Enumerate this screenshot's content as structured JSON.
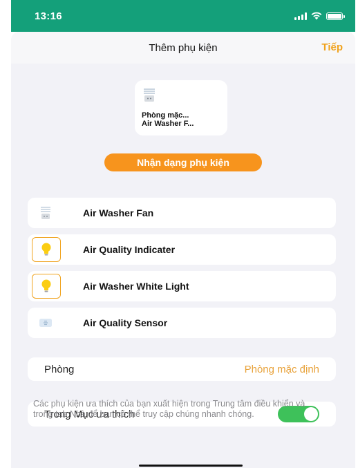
{
  "status_bar": {
    "time": "13:16"
  },
  "navbar": {
    "title": "Thêm phụ kiện",
    "next_label": "Tiếp"
  },
  "accessory_tile": {
    "name_line1": "Phòng mặc...",
    "name_line2": "Air Washer F..."
  },
  "identify_button": {
    "label": "Nhận dạng phụ kiện"
  },
  "accessories": [
    {
      "label": "Air Washer Fan",
      "icon": "air-washer-fan-icon"
    },
    {
      "label": "Air Quality Indicater",
      "icon": "lightbulb-icon"
    },
    {
      "label": "Air Washer White Light",
      "icon": "lightbulb-icon"
    },
    {
      "label": "Air Quality Sensor",
      "icon": "sensor-icon"
    }
  ],
  "room": {
    "label": "Phòng",
    "value": "Phòng mặc định"
  },
  "favorites": {
    "label": "Trong Mục ưa thích",
    "enabled": true
  },
  "footnote": "Các phụ kiện ưa thích của bạn xuất hiện trong Trung tâm điều khiển và trong tab Nhà để bạn có thể truy cập chúng nhanh chóng.",
  "colors": {
    "accent": "#f0a21c",
    "button": "#f7941d",
    "toggle_on": "#3ec15a",
    "status_bar": "#14a07a"
  }
}
